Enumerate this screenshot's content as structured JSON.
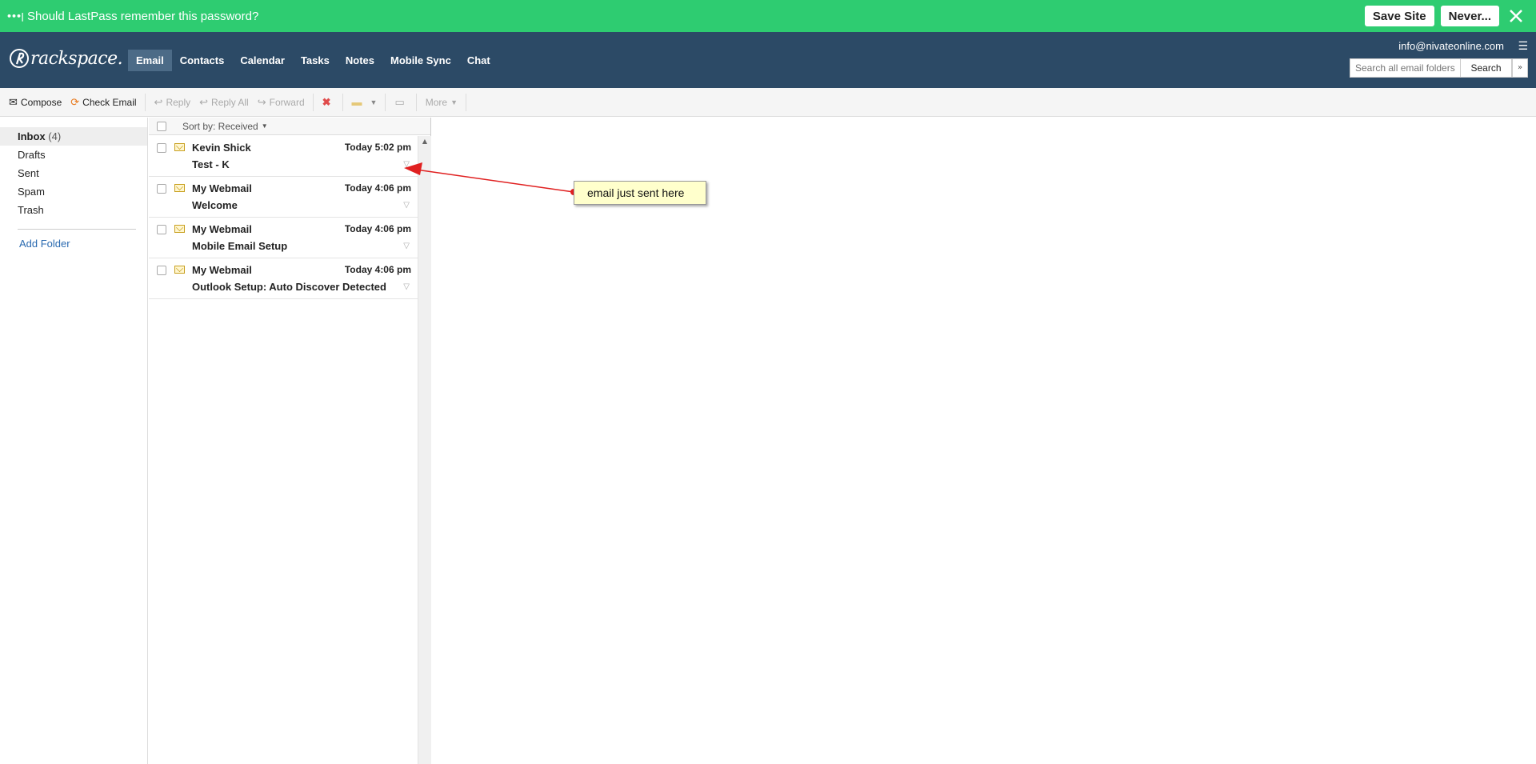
{
  "lastpass": {
    "dots": "•••|",
    "prompt": "Should LastPass remember this password?",
    "save_label": "Save Site",
    "never_label": "Never..."
  },
  "header": {
    "logo_text": "rackspace.",
    "nav": [
      "Email",
      "Contacts",
      "Calendar",
      "Tasks",
      "Notes",
      "Mobile Sync",
      "Chat"
    ],
    "active_nav": "Email",
    "account": "info@nivateonline.com",
    "search_placeholder": "Search all email folders",
    "search_label": "Search"
  },
  "toolbar": {
    "compose": "Compose",
    "check_email": "Check Email",
    "reply": "Reply",
    "reply_all": "Reply All",
    "forward": "Forward",
    "more": "More"
  },
  "folders": {
    "items": [
      {
        "label": "Inbox",
        "count": "(4)"
      },
      {
        "label": "Drafts"
      },
      {
        "label": "Sent"
      },
      {
        "label": "Spam"
      },
      {
        "label": "Trash"
      }
    ],
    "add_folder": "Add Folder"
  },
  "list": {
    "sort_label": "Sort by: Received",
    "messages": [
      {
        "from": "Kevin Shick",
        "time": "Today 5:02 pm",
        "subject": "Test - K"
      },
      {
        "from": "My Webmail",
        "time": "Today 4:06 pm",
        "subject": "Welcome"
      },
      {
        "from": "My Webmail",
        "time": "Today 4:06 pm",
        "subject": "Mobile Email Setup"
      },
      {
        "from": "My Webmail",
        "time": "Today 4:06 pm",
        "subject": "Outlook Setup: Auto Discover Detected"
      }
    ]
  },
  "annotation": {
    "text": "email just sent here"
  },
  "colors": {
    "lastpass_green": "#2ecc71",
    "header_navy": "#2c4a66",
    "active_nav": "#4c6b87",
    "link_blue": "#2a6ab0",
    "arrow_red": "#e02020",
    "note_yellow": "#ffffcc"
  }
}
